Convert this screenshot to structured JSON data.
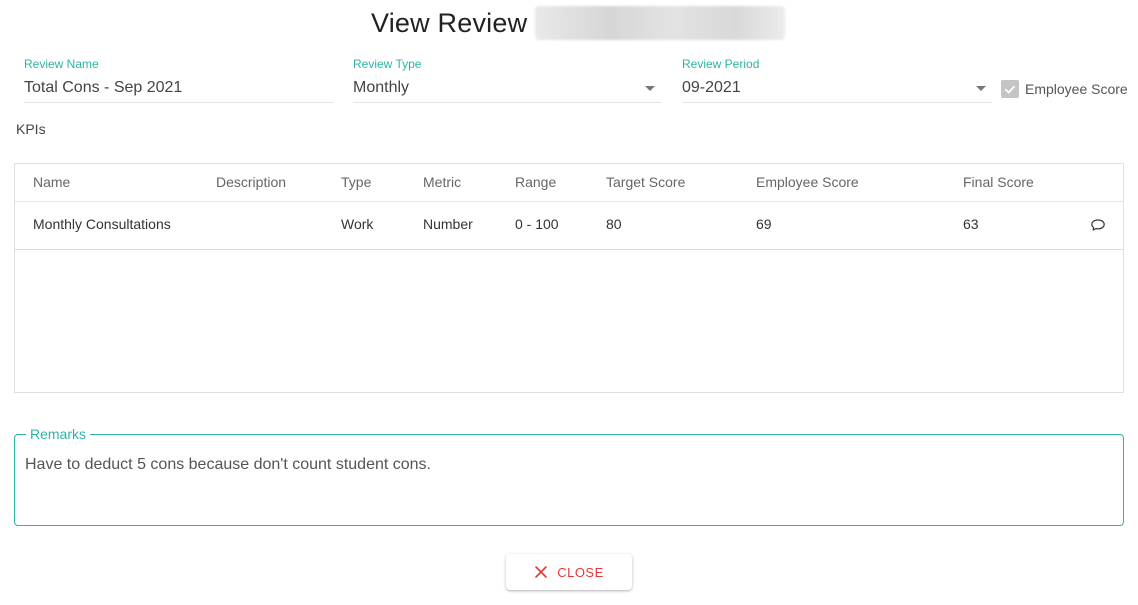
{
  "dialog": {
    "title": "View Review"
  },
  "form": {
    "review_name": {
      "label": "Review Name",
      "value": "Total Cons - Sep 2021"
    },
    "review_type": {
      "label": "Review Type",
      "value": "Monthly"
    },
    "review_period": {
      "label": "Review Period",
      "value": "09-2021"
    },
    "employee_score_checkbox": {
      "label": "Employee Score",
      "checked": true
    }
  },
  "kpis": {
    "label": "KPIs",
    "columns": [
      "Name",
      "Description",
      "Type",
      "Metric",
      "Range",
      "Target Score",
      "Employee Score",
      "Final Score"
    ],
    "rows": [
      {
        "name": "Monthly Consultations",
        "description": "",
        "type": "Work",
        "metric": "Number",
        "range": "0 - 100",
        "target_score": "80",
        "employee_score": "69",
        "final_score": "63",
        "action_icon": "comment-icon"
      }
    ]
  },
  "remarks": {
    "label": "Remarks",
    "text": "Have to deduct 5 cons because don't count student cons."
  },
  "actions": {
    "close_label": "CLOSE",
    "close_icon": "close-icon"
  },
  "colors": {
    "accent": "#2bb5a3",
    "danger": "#e53935",
    "checkbox": "#c4c4c4"
  }
}
